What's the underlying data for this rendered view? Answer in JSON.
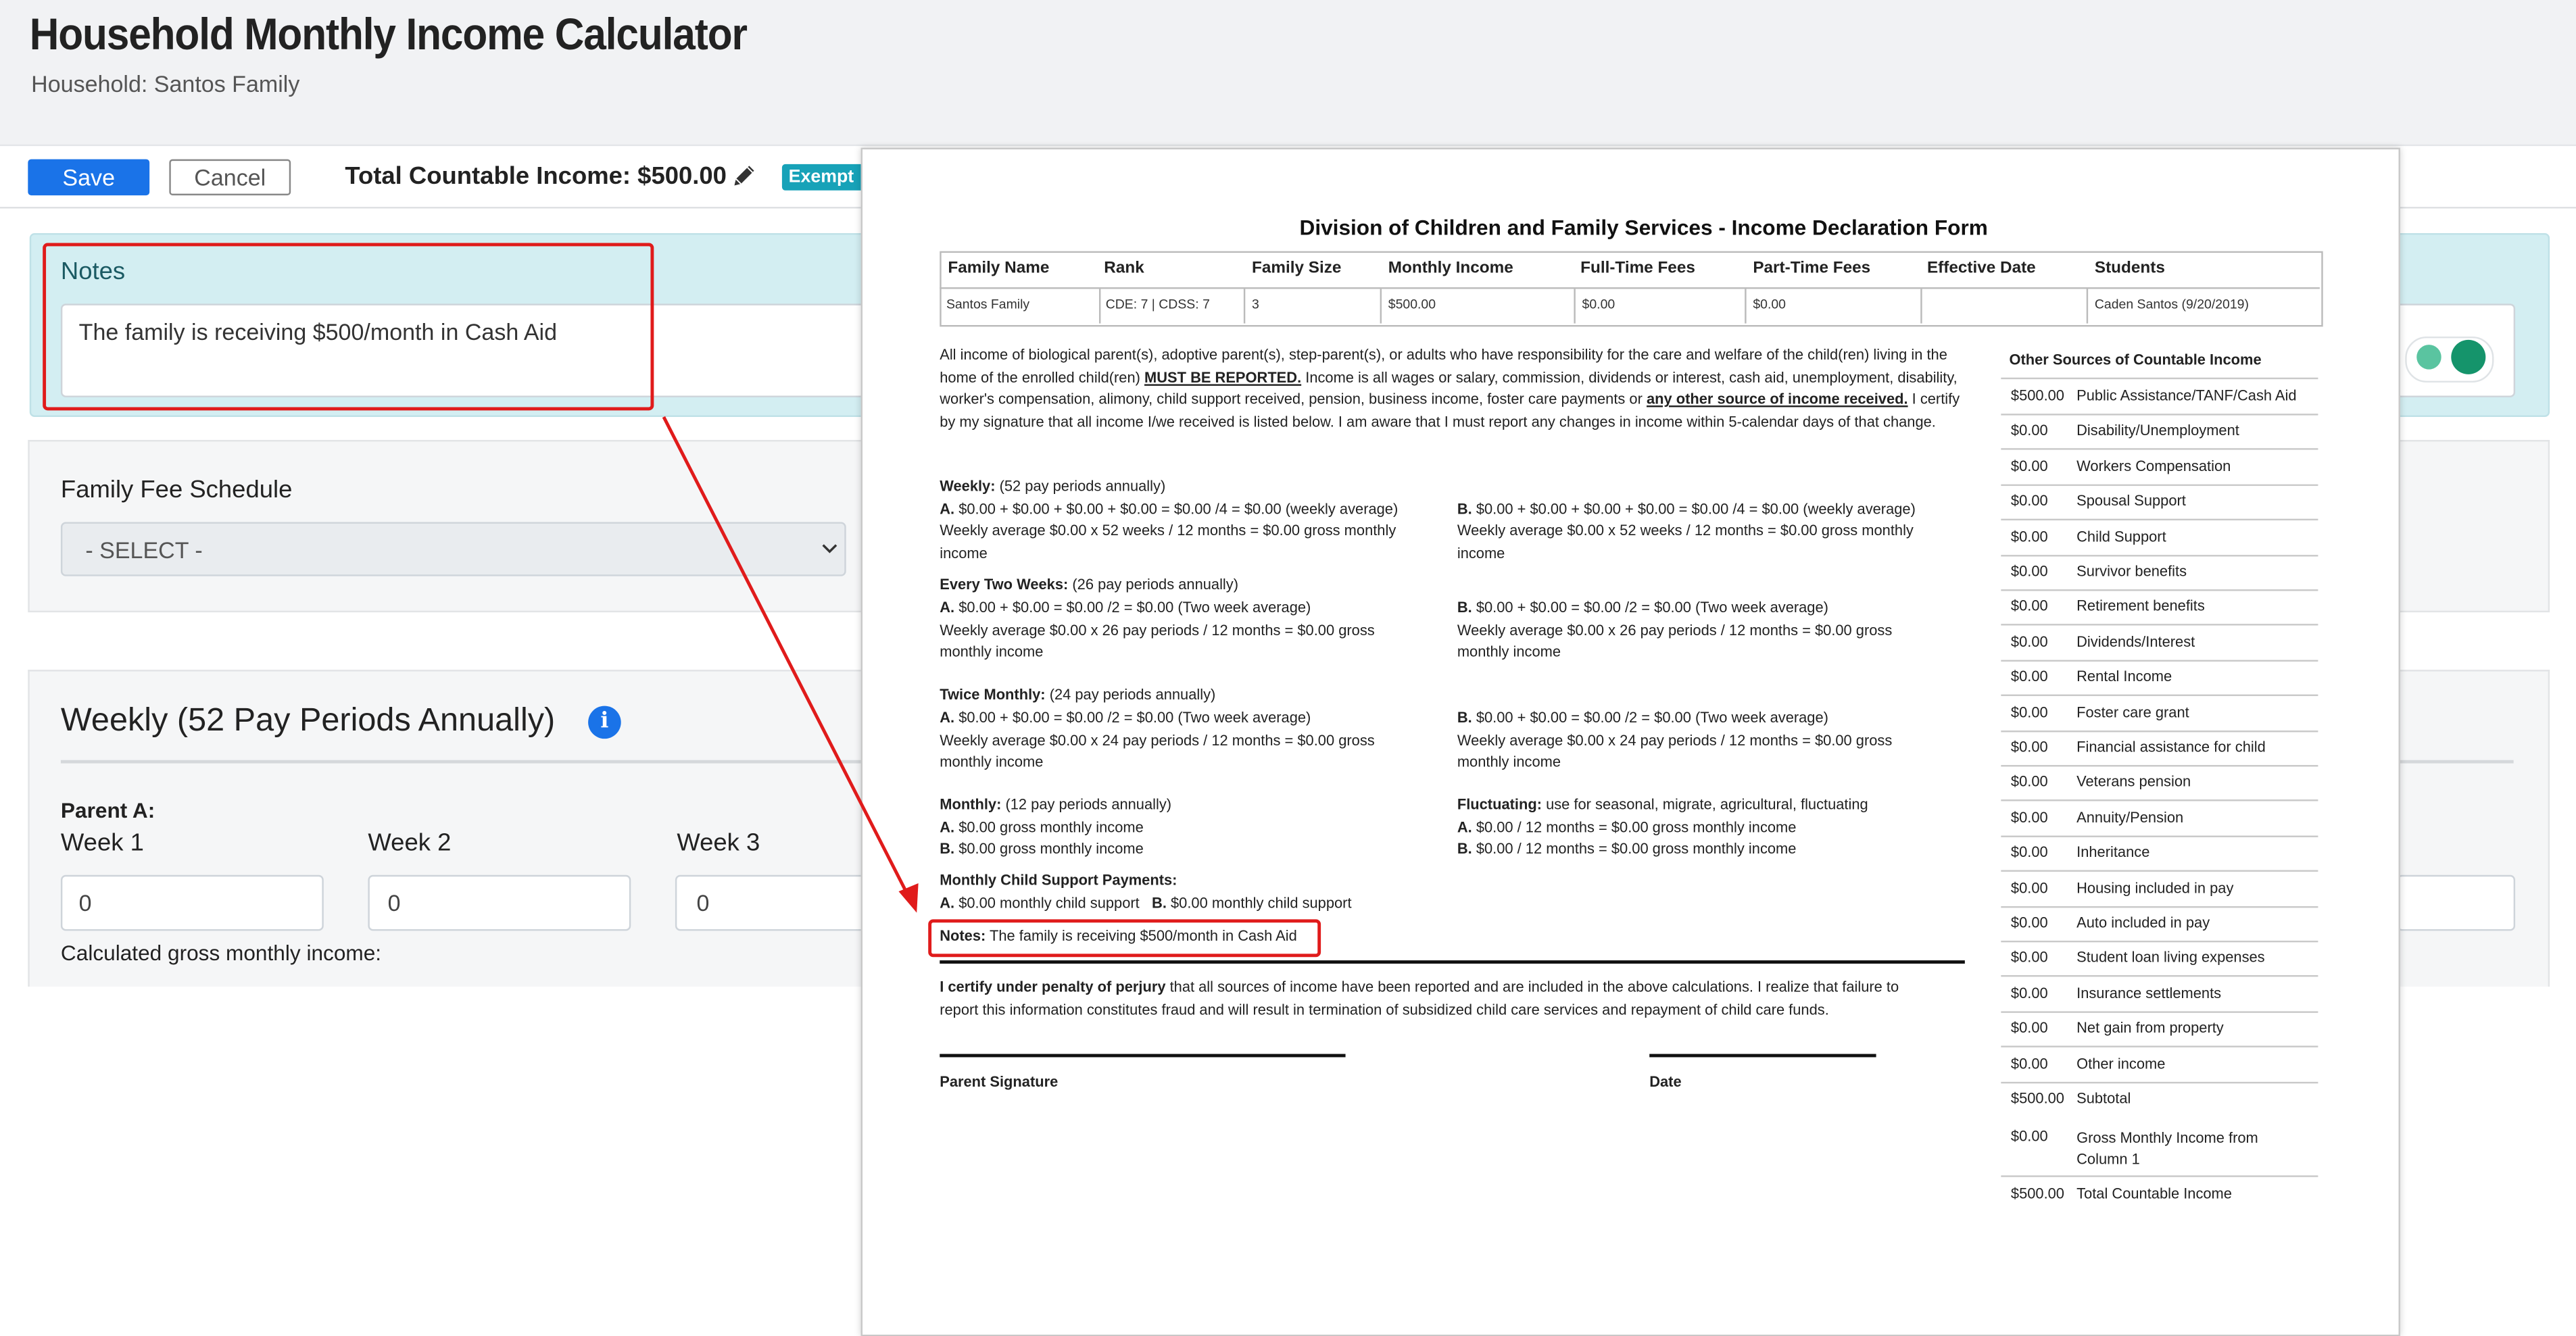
{
  "app": {
    "title": "Household Monthly Income Calculator",
    "subtitle": "Household: Santos Family"
  },
  "toolbar": {
    "save_label": "Save",
    "cancel_label": "Cancel",
    "total_label": "Total Countable Income: $500.00",
    "exempt_label": "Exempt"
  },
  "notes": {
    "title": "Notes",
    "text": "The family is receiving $500/month in Cash Aid"
  },
  "fee_schedule": {
    "title": "Family Fee Schedule",
    "selected": "- SELECT -"
  },
  "weekly": {
    "title": "Weekly (52 Pay Periods Annually)",
    "parent_label": "Parent A:",
    "weeks": [
      {
        "label": "Week 1",
        "value": "0"
      },
      {
        "label": "Week 2",
        "value": "0"
      },
      {
        "label": "Week 3",
        "value": "0"
      }
    ],
    "calc_label": "Calculated gross monthly income:"
  },
  "document": {
    "title": "Division of Children and Family Services - Income Declaration Form",
    "table_headers": [
      "Family Name",
      "Rank",
      "Family Size",
      "Monthly Income",
      "Full-Time Fees",
      "Part-Time Fees",
      "Effective Date",
      "Students"
    ],
    "table_row": [
      "Santos Family",
      "CDE: 7 | CDSS: 7",
      "3",
      "$500.00",
      "$0.00",
      "$0.00",
      "",
      "Caden Santos (9/20/2019)"
    ],
    "intro_1": "All income of biological parent(s), adoptive parent(s), step-parent(s), or adults who have responsibility for the care and welfare of the child(ren) living in the home of the enrolled child(ren) ",
    "intro_must": "MUST BE REPORTED.",
    "intro_2": " Income is all wages or salary, commission, dividends or interest, cash aid, unemployment, disability, worker's compensation, alimony, child support received, pension, business income, foster care payments or ",
    "intro_other": "any other source of income received.",
    "intro_3": " I certify by my signature that all income I/we received is listed below. I am aware that I must report any changes in income within 5-calendar days of that change.",
    "weekly_head": "Weekly:",
    "weekly_head_rest": " (52 pay periods annually)",
    "weekly_a": "$0.00 + $0.00 + $0.00 + $0.00 = $0.00 /4 = $0.00 (weekly average)",
    "weekly_a2": "Weekly average $0.00 x 52 weeks / 12 months = $0.00 gross monthly",
    "weekly_b": "$0.00 + $0.00 + $0.00 + $0.00 = $0.00 /4 = $0.00 (weekly average)",
    "weekly_b2": "Weekly average $0.00 x 52 weeks / 12 months = $0.00 gross monthly",
    "income_word": "income",
    "biweekly_head": "Every Two Weeks:",
    "biweekly_head_rest": " (26 pay periods annually)",
    "biweekly_a": "$0.00 + $0.00 = $0.00 /2 = $0.00 (Two week average)",
    "biweekly_a2": "Weekly average $0.00 x 26 pay periods / 12 months = $0.00 gross",
    "biweekly_b": "$0.00 + $0.00 = $0.00 /2 = $0.00 (Two week average)",
    "biweekly_b2": "Weekly average $0.00 x 26 pay periods / 12 months = $0.00 gross",
    "monthly_income_word": "monthly income",
    "twice_head": "Twice Monthly:",
    "twice_head_rest": " (24 pay periods annually)",
    "twice_a": "$0.00 + $0.00 = $0.00 /2 = $0.00 (Two week average)",
    "twice_a2": "Weekly average $0.00 x 24 pay periods / 12 months = $0.00 gross",
    "twice_b": "$0.00 + $0.00 = $0.00 /2 = $0.00 (Two week average)",
    "twice_b2": "Weekly average $0.00 x 24 pay periods / 12 months = $0.00 gross",
    "monthly_head": "Monthly:",
    "monthly_head_rest": " (12 pay periods annually)",
    "monthly_a": "$0.00 gross monthly income",
    "monthly_b": "$0.00 gross monthly income",
    "fluct_head": "Fluctuating:",
    "fluct_head_rest": " use for seasonal, migrate, agricultural, fluctuating",
    "fluct_a": "$0.00 / 12 months = $0.00 gross monthly income",
    "fluct_b": "$0.00 / 12 months = $0.00 gross monthly income",
    "child_support_head": "Monthly Child Support Payments:",
    "child_support_a": "$0.00 monthly child support",
    "child_support_b": "$0.00 monthly child support",
    "label_a": "A.",
    "label_b": "B.",
    "notes_label": "Notes:",
    "notes_text": "The family is receiving $500/month in Cash Aid",
    "certify_head": "I certify under penalty of perjury",
    "certify_1": " that all sources of income have been reported and are included in the above calculations. I realize that failure to",
    "certify_2": "report this information constitutes fraud and will result in termination of subsidized child care services and repayment of child care funds.",
    "signature_label": "Parent Signature",
    "date_label": "Date",
    "other_sources_title": "Other Sources of Countable Income",
    "other_sources": [
      {
        "amount": "$500.00",
        "label": "Public Assistance/TANF/Cash Aid"
      },
      {
        "amount": "$0.00",
        "label": "Disability/Unemployment"
      },
      {
        "amount": "$0.00",
        "label": "Workers Compensation"
      },
      {
        "amount": "$0.00",
        "label": "Spousal Support"
      },
      {
        "amount": "$0.00",
        "label": "Child Support"
      },
      {
        "amount": "$0.00",
        "label": "Survivor benefits"
      },
      {
        "amount": "$0.00",
        "label": "Retirement benefits"
      },
      {
        "amount": "$0.00",
        "label": "Dividends/Interest"
      },
      {
        "amount": "$0.00",
        "label": "Rental Income"
      },
      {
        "amount": "$0.00",
        "label": "Foster care grant"
      },
      {
        "amount": "$0.00",
        "label": "Financial assistance for child"
      },
      {
        "amount": "$0.00",
        "label": "Veterans pension"
      },
      {
        "amount": "$0.00",
        "label": "Annuity/Pension"
      },
      {
        "amount": "$0.00",
        "label": "Inheritance"
      },
      {
        "amount": "$0.00",
        "label": "Housing included in pay"
      },
      {
        "amount": "$0.00",
        "label": "Auto included in pay"
      },
      {
        "amount": "$0.00",
        "label": "Student loan living expenses"
      },
      {
        "amount": "$0.00",
        "label": "Insurance settlements"
      },
      {
        "amount": "$0.00",
        "label": "Net gain from property"
      },
      {
        "amount": "$0.00",
        "label": "Other income"
      },
      {
        "amount": "$500.00",
        "label": "Subtotal"
      }
    ],
    "gross_monthly_amount": "$0.00",
    "gross_monthly_label_1": "Gross Monthly Income from",
    "gross_monthly_label_2": "Column 1",
    "total_amount": "$500.00",
    "total_label": "Total Countable Income"
  },
  "colors": {
    "primary": "#1a73e8",
    "info": "#17a2b8",
    "highlight": "#e01b1b",
    "notes_bg": "#d3eef2"
  },
  "icons": [
    "pencil-icon",
    "chevron-down-icon",
    "info-icon",
    "grammarly-icon"
  ]
}
